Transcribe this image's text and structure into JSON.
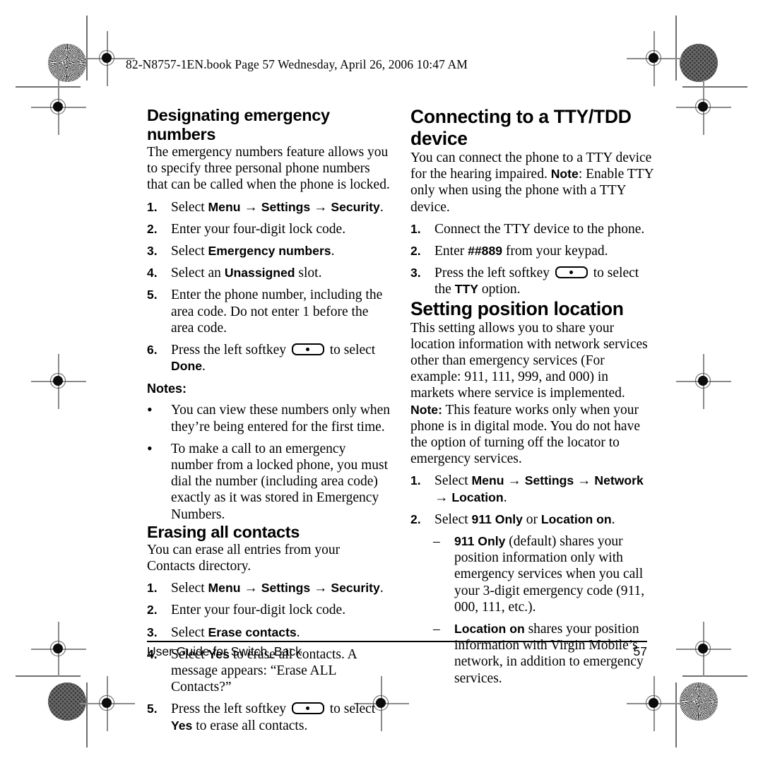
{
  "page_header": "82-N8757-1EN.book  Page 57  Wednesday, April 26, 2006  10:47 AM",
  "footer": {
    "left": "User Guide for Switch_Back",
    "page_number": "57"
  },
  "icons": {
    "softkey": "softkey-button-icon",
    "registration": "registration-mark-icon",
    "rosette": "print-rosette-icon",
    "dotscreen": "print-dot-screen-icon"
  },
  "left_column": {
    "section1": {
      "heading": "Designating emergency numbers",
      "intro": "The emergency numbers feature allows you to specify three personal phone numbers that can be called when the phone is locked.",
      "steps": [
        {
          "marker": "1.",
          "parts": [
            {
              "t": "text",
              "v": "Select "
            },
            {
              "t": "ui",
              "v": "Menu"
            },
            {
              "t": "arrow",
              "v": " → "
            },
            {
              "t": "ui",
              "v": "Settings"
            },
            {
              "t": "arrow",
              "v": " → "
            },
            {
              "t": "ui",
              "v": "Security"
            },
            {
              "t": "text",
              "v": "."
            }
          ]
        },
        {
          "marker": "2.",
          "parts": [
            {
              "t": "text",
              "v": "Enter your four-digit lock code."
            }
          ]
        },
        {
          "marker": "3.",
          "parts": [
            {
              "t": "text",
              "v": "Select "
            },
            {
              "t": "ui",
              "v": "Emergency numbers"
            },
            {
              "t": "text",
              "v": "."
            }
          ]
        },
        {
          "marker": "4.",
          "parts": [
            {
              "t": "text",
              "v": "Select an "
            },
            {
              "t": "ui",
              "v": "Unassigned"
            },
            {
              "t": "text",
              "v": " slot."
            }
          ]
        },
        {
          "marker": "5.",
          "parts": [
            {
              "t": "text",
              "v": "Enter the phone number, including the area code. Do not enter 1 before the area code."
            }
          ]
        },
        {
          "marker": "6.",
          "parts": [
            {
              "t": "text",
              "v": "Press the left softkey "
            },
            {
              "t": "softkey",
              "v": ""
            },
            {
              "t": "text",
              "v": " to select "
            },
            {
              "t": "ui",
              "v": "Done"
            },
            {
              "t": "text",
              "v": "."
            }
          ]
        }
      ],
      "notes_label": "Notes:",
      "notes": [
        {
          "marker": "•",
          "parts": [
            {
              "t": "text",
              "v": "You can view these numbers only when they’re being entered for the first time."
            }
          ]
        },
        {
          "marker": "•",
          "parts": [
            {
              "t": "text",
              "v": "To make a call to an emergency number from a locked phone, you must dial the number (including area code) exactly as it was stored in Emergency Numbers."
            }
          ]
        }
      ]
    },
    "section2": {
      "heading": "Erasing all contacts",
      "intro": "You can erase all entries from your Contacts directory.",
      "steps": [
        {
          "marker": "1.",
          "parts": [
            {
              "t": "text",
              "v": "Select "
            },
            {
              "t": "ui",
              "v": "Menu"
            },
            {
              "t": "arrow",
              "v": " → "
            },
            {
              "t": "ui",
              "v": "Settings"
            },
            {
              "t": "arrow",
              "v": " → "
            },
            {
              "t": "ui",
              "v": "Security"
            },
            {
              "t": "text",
              "v": "."
            }
          ]
        },
        {
          "marker": "2.",
          "parts": [
            {
              "t": "text",
              "v": "Enter your four-digit lock code."
            }
          ]
        },
        {
          "marker": "3.",
          "parts": [
            {
              "t": "text",
              "v": "Select "
            },
            {
              "t": "ui",
              "v": "Erase contacts"
            },
            {
              "t": "text",
              "v": "."
            }
          ]
        },
        {
          "marker": "4.",
          "parts": [
            {
              "t": "text",
              "v": "Select "
            },
            {
              "t": "ui",
              "v": "Yes"
            },
            {
              "t": "text",
              "v": " to erase all contacts. A message appears: “Erase ALL Contacts?”"
            }
          ]
        },
        {
          "marker": "5.",
          "parts": [
            {
              "t": "text",
              "v": "Press the left softkey "
            },
            {
              "t": "softkey",
              "v": ""
            },
            {
              "t": "text",
              "v": " to select "
            },
            {
              "t": "ui",
              "v": "Yes"
            },
            {
              "t": "text",
              "v": " to erase all contacts."
            }
          ]
        }
      ]
    }
  },
  "right_column": {
    "section1": {
      "heading": "Connecting to a TTY/TDD device",
      "intro_parts": [
        {
          "t": "text",
          "v": "You can connect the phone to a TTY device for the hearing impaired. "
        },
        {
          "t": "ui",
          "v": "Note"
        },
        {
          "t": "text",
          "v": ": Enable TTY only when using the phone with a TTY device."
        }
      ],
      "steps": [
        {
          "marker": "1.",
          "parts": [
            {
              "t": "text",
              "v": "Connect the TTY device to the phone."
            }
          ]
        },
        {
          "marker": "2.",
          "parts": [
            {
              "t": "text",
              "v": "Enter "
            },
            {
              "t": "ui",
              "v": "##889"
            },
            {
              "t": "text",
              "v": " from your keypad."
            }
          ]
        },
        {
          "marker": "3.",
          "parts": [
            {
              "t": "text",
              "v": "Press the left softkey "
            },
            {
              "t": "softkey",
              "v": ""
            },
            {
              "t": "text",
              "v": " to select the "
            },
            {
              "t": "ui",
              "v": "TTY"
            },
            {
              "t": "text",
              "v": " option."
            }
          ]
        }
      ]
    },
    "section2": {
      "heading": "Setting position location",
      "intro": "This setting allows you to share your location information with network services other than emergency services (For example: 911, 111, 999, and 000) in markets where service is implemented.",
      "note_parts": [
        {
          "t": "ui",
          "v": "Note:"
        },
        {
          "t": "text",
          "v": "  This feature works only when your phone is in digital mode. You do not have the option of turning off the locator to emergency services."
        }
      ],
      "steps": [
        {
          "marker": "1.",
          "parts": [
            {
              "t": "text",
              "v": "Select "
            },
            {
              "t": "ui",
              "v": "Menu"
            },
            {
              "t": "arrow",
              "v": " → "
            },
            {
              "t": "ui",
              "v": "Settings"
            },
            {
              "t": "arrow",
              "v": " → "
            },
            {
              "t": "ui",
              "v": "Network"
            },
            {
              "t": "arrow",
              "v": " → "
            },
            {
              "t": "ui",
              "v": "Location"
            },
            {
              "t": "text",
              "v": "."
            }
          ]
        },
        {
          "marker": "2.",
          "parts": [
            {
              "t": "text",
              "v": "Select "
            },
            {
              "t": "ui",
              "v": "911 Only"
            },
            {
              "t": "text",
              "v": " or "
            },
            {
              "t": "ui",
              "v": "Location on"
            },
            {
              "t": "text",
              "v": "."
            }
          ]
        }
      ],
      "sub_items": [
        {
          "marker": "–",
          "parts": [
            {
              "t": "ui",
              "v": "911 Only"
            },
            {
              "t": "text",
              "v": " (default) shares your position information only with emergency services when you call your 3-digit emergency code (911, 000, 111, etc.)."
            }
          ]
        },
        {
          "marker": "–",
          "parts": [
            {
              "t": "ui",
              "v": "Location on"
            },
            {
              "t": "text",
              "v": " shares your position information with Virgin Mobile’s network, in addition to emergency services."
            }
          ]
        }
      ]
    }
  }
}
